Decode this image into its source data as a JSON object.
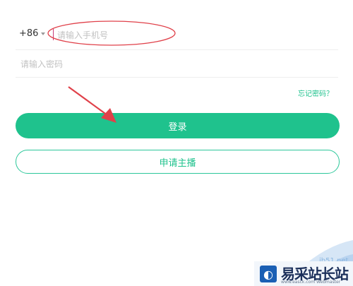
{
  "login": {
    "country_code": "+86",
    "phone_placeholder": "请输入手机号",
    "password_placeholder": "请输入密码",
    "forgot_label": "忘记密码？",
    "login_label": "登录",
    "apply_label": "申请主播"
  },
  "colors": {
    "accent": "#1fc28d",
    "annotation": "#e0414a"
  },
  "watermark": {
    "name": "易采站长站",
    "url_fragment": "jb51.net",
    "subtitle": "www.easck.com Webmaster"
  }
}
